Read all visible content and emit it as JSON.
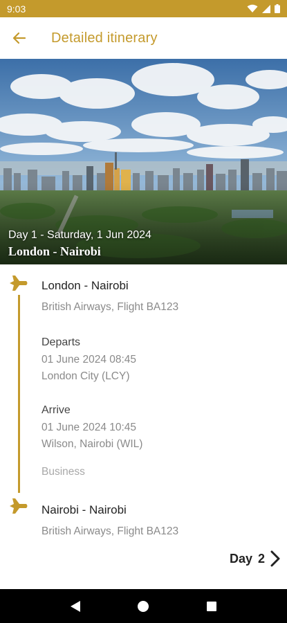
{
  "status_bar": {
    "time": "9:03"
  },
  "app_bar": {
    "title": "Detailed itinerary"
  },
  "hero": {
    "date": "Day 1 - Saturday, 1 Jun 2024",
    "route": "London - Nairobi"
  },
  "segments": [
    {
      "title": "London - Nairobi",
      "carrier": "British Airways, Flight BA123",
      "departs_label": "Departs",
      "departs_time": "01 June 2024 08:45",
      "departs_place": "London City (LCY)",
      "arrive_label": "Arrive",
      "arrive_time": "01 June 2024 10:45",
      "arrive_place": "Wilson, Nairobi (WIL)",
      "cabin": "Business"
    },
    {
      "title": "Nairobi - Nairobi",
      "carrier": "British Airways, Flight BA123"
    }
  ],
  "day_nav": {
    "label": "Day",
    "number": "2"
  },
  "colors": {
    "accent": "#c49a2c"
  },
  "icons": [
    "back-arrow-icon",
    "plane-icon",
    "chevron-right-icon",
    "wifi-icon",
    "signal-icon",
    "battery-icon",
    "nav-back-icon",
    "nav-home-icon",
    "nav-recents-icon"
  ]
}
